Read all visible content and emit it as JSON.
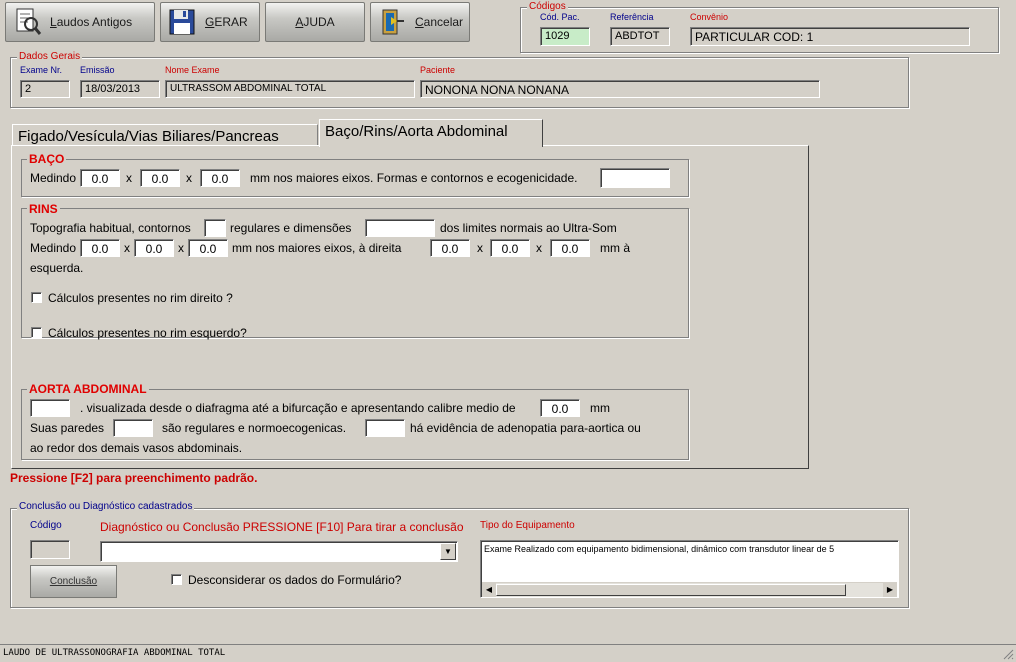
{
  "toolbar": {
    "laudos_antigos": {
      "prefix": "",
      "underline": "L",
      "rest": "audos Antigos"
    },
    "gerar": {
      "prefix": "",
      "underline": "G",
      "rest": "ERAR"
    },
    "ajuda": {
      "prefix": "",
      "underline": "A",
      "rest": "JUDA"
    },
    "cancelar": {
      "prefix": "",
      "underline": "C",
      "rest": "ancelar"
    }
  },
  "codigos": {
    "legend": "Códigos",
    "cod_pac_label": "Cód. Pac.",
    "cod_pac_value": "1029",
    "referencia_label": "Referência",
    "referencia_value": "ABDTOT",
    "convenio_label": "Convênio",
    "convenio_value": "PARTICULAR COD: 1"
  },
  "dados_gerais": {
    "legend": "Dados Gerais",
    "exame_nr_label": "Exame Nr.",
    "exame_nr_value": "2",
    "emissao_label": "Emissão",
    "emissao_value": "18/03/2013",
    "nome_exame_label": "Nome Exame",
    "nome_exame_value": "ULTRASSOM ABDOMINAL TOTAL",
    "paciente_label": "Paciente",
    "paciente_value": "NONONA NONA NONANA"
  },
  "tabs": [
    {
      "label": "Figado/Vesícula/Vias Biliares/Pancreas",
      "active": false
    },
    {
      "label": "Baço/Rins/Aorta Abdominal",
      "active": true
    }
  ],
  "baco": {
    "legend": "BAÇO",
    "medindo": "Medindo",
    "x": "x",
    "v1": "0.0",
    "v2": "0.0",
    "v3": "0.0",
    "suffix": "mm nos maiores eixos. Formas e contornos e ecogenicidade.",
    "eco_value": ""
  },
  "rins": {
    "legend": "RINS",
    "line1_a": "Topografia habitual, contornos",
    "line1_b": "regulares e dimensões",
    "line1_c": "dos limites normais ao Ultra-Som",
    "medindo": "Medindo",
    "x": "x",
    "d1": "0.0",
    "d2": "0.0",
    "d3": "0.0",
    "mid": "mm nos maiores eixos, à direita",
    "e1": "0.0",
    "e2": "0.0",
    "e3": "0.0",
    "end": "mm à",
    "esquerda": "esquerda.",
    "calc_direito": "Cálculos presentes no rim direito ?",
    "calc_esquerdo": "Cálculos presentes no rim esquerdo?"
  },
  "aorta": {
    "legend": "AORTA ABDOMINAL",
    "line1": ". visualizada desde o diafragma até a bifurcação e apresentando calibre medio de",
    "calibre": "0.0",
    "mm": "mm",
    "paredes_a": "Suas paredes",
    "paredes_b": "são regulares e normoecogenicas.",
    "adeno": "há evidência de adenopatia para-aortica ou",
    "line3": "ao redor dos demais vasos abdominais."
  },
  "hint": "Pressione [F2] para preenchimento padrão.",
  "conclusao": {
    "legend": "Conclusão ou Diagnóstico cadastrados",
    "codigo_label": "Código",
    "diag_label": "Diagnóstico ou Conclusão PRESSIONE [F10] Para tirar a conclusão",
    "tipo_label": "Tipo do Equipamento",
    "equip_text": "Exame Realizado com equipamento bidimensional, dinâmico com transdutor linear de 5",
    "conclusao_button": "Conclusão",
    "desconsiderar": "Desconsiderar os dados do Formulário?"
  },
  "status_bar": "LAUDO DE ULTRASSONOGRAFIA ABDOMINAL TOTAL"
}
